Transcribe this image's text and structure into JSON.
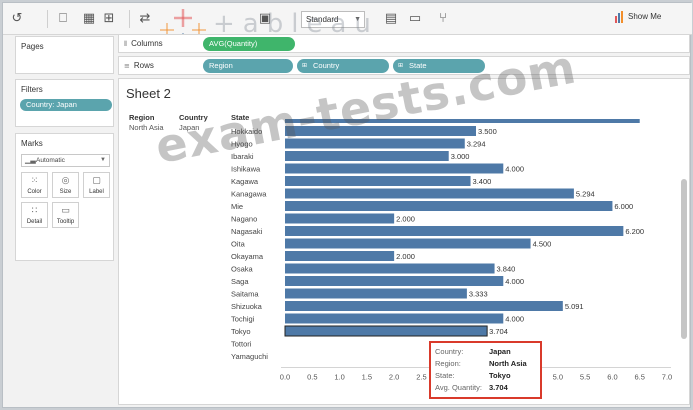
{
  "toolbar": {
    "standard_label": "Standard",
    "show_me_label": "Show Me",
    "logo_text": "+ableau"
  },
  "panels": {
    "pages_title": "Pages",
    "filters_title": "Filters",
    "filter_pill": "Country: Japan",
    "marks_title": "Marks",
    "marks_type": "Automatic",
    "marks_cards": [
      "Color",
      "Size",
      "Label",
      "Detail",
      "Tooltip"
    ]
  },
  "shelves": {
    "columns_label": "Columns",
    "columns_pill": "AVG(Quantity)",
    "rows_label": "Rows",
    "rows_pills": [
      "Region",
      "Country",
      "State"
    ]
  },
  "sheet": {
    "title": "Sheet 2",
    "headers": [
      "Region",
      "Country",
      "State"
    ],
    "region": "North Asia",
    "country": "Japan"
  },
  "chart_data": {
    "type": "bar",
    "orientation": "horizontal",
    "categories": [
      "Hokkaido",
      "Hyogo",
      "Ibaraki",
      "Ishikawa",
      "Kagawa",
      "Kanagawa",
      "Mie",
      "Nagano",
      "Nagasaki",
      "Oita",
      "Okayama",
      "Osaka",
      "Saga",
      "Saitama",
      "Shizuoka",
      "Tochigi",
      "Tokyo",
      "Tottori",
      "Yamaguchi"
    ],
    "category_labels": [
      "Hokkaido",
      "Hyogo",
      "Ibaraki",
      "Ishikawa",
      "Kagawa",
      "Kanagawa",
      "Mie",
      "Nagano",
      "Nagasaki",
      "Oita",
      "Okayama",
      "Osaka",
      "Saga",
      "Saitama",
      "Shizuoka",
      "Tochigi",
      "Tokyo",
      "Tottori",
      "Yamaguchi"
    ],
    "values": [
      3.5,
      3.294,
      3.0,
      4.0,
      3.4,
      5.294,
      6.0,
      2.0,
      6.2,
      4.5,
      2.0,
      3.84,
      4.0,
      3.333,
      5.091,
      4.0,
      3.704,
      null,
      null
    ],
    "value_labels": [
      "3.500",
      "3.294",
      "3.000",
      "4.000",
      "3.400",
      "5.294",
      "6.000",
      "2.000",
      "6.200",
      "4.500",
      "2.000",
      "3.840",
      "4.000",
      "3.333",
      "5.091",
      "4.000",
      "3.704",
      "",
      ""
    ],
    "partial_top_bar_value": 6.5,
    "ticks": [
      "0.0",
      "0.5",
      "1.0",
      "1.5",
      "2.0",
      "2.5",
      "3.0",
      "3.5",
      "4.0",
      "4.5",
      "5.0",
      "5.5",
      "6.0",
      "6.5",
      "7.0"
    ],
    "xlim": [
      0,
      7
    ],
    "bar_color": "#4e79a7",
    "highlight": "Tokyo"
  },
  "tooltip": {
    "rows": [
      {
        "key": "Country:",
        "value": "Japan"
      },
      {
        "key": "Region:",
        "value": "North Asia"
      },
      {
        "key": "State:",
        "value": "Tokyo"
      },
      {
        "key": "Avg. Quantity:",
        "value": "3.704"
      }
    ]
  },
  "watermark": "exam-tests.com"
}
